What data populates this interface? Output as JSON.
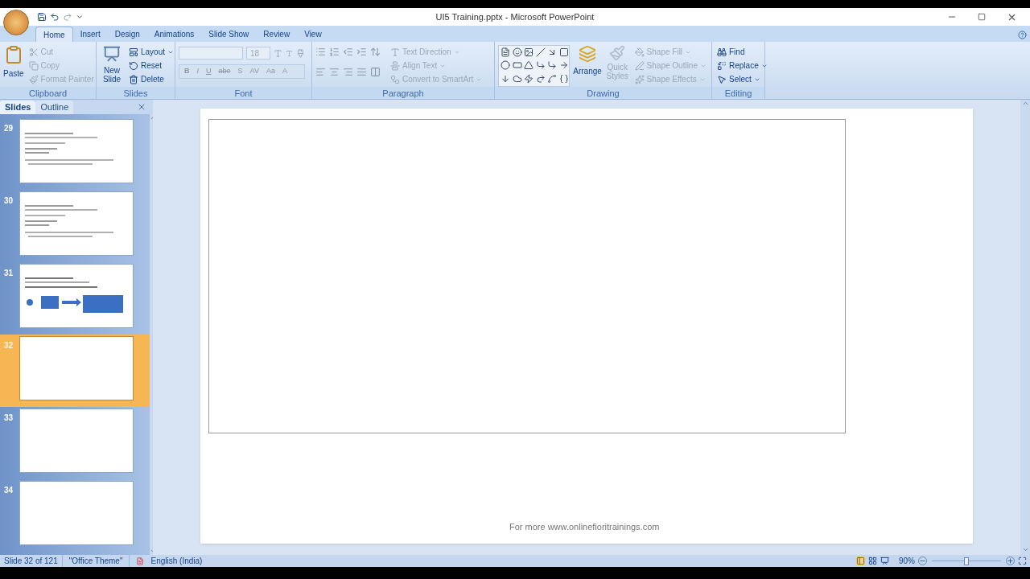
{
  "window": {
    "title": "UI5 Training.pptx - Microsoft PowerPoint"
  },
  "ribbon_tabs": [
    {
      "label": "Home",
      "selected": true
    },
    {
      "label": "Insert",
      "selected": false
    },
    {
      "label": "Design",
      "selected": false
    },
    {
      "label": "Animations",
      "selected": false
    },
    {
      "label": "Slide Show",
      "selected": false
    },
    {
      "label": "Review",
      "selected": false
    },
    {
      "label": "View",
      "selected": false
    }
  ],
  "ribbon": {
    "clipboard": {
      "title": "Clipboard",
      "paste": {
        "label": "Paste",
        "disabled": false
      },
      "small": [
        {
          "label": "Cut",
          "disabled": true,
          "menu": false
        },
        {
          "label": "Copy",
          "disabled": true,
          "menu": false
        },
        {
          "label": "Format Painter",
          "disabled": true,
          "menu": false
        }
      ]
    },
    "slides": {
      "title": "Slides",
      "new_slide": {
        "label": "New Slide",
        "disabled": false
      },
      "small": [
        {
          "label": "Layout",
          "disabled": false,
          "menu": true
        },
        {
          "label": "Reset",
          "disabled": false,
          "menu": false
        },
        {
          "label": "Delete",
          "disabled": false,
          "menu": false
        }
      ]
    },
    "font": {
      "title": "Font",
      "size": "18",
      "format_buttons": [
        "B",
        "I",
        "U",
        "abe",
        "S",
        "AV",
        "Aa",
        "A"
      ]
    },
    "paragraph": {
      "title": "Paragraph",
      "small": [
        {
          "label": "Text Direction",
          "disabled": true,
          "menu": true
        },
        {
          "label": "Align Text",
          "disabled": true,
          "menu": true
        },
        {
          "label": "Convert to SmartArt",
          "disabled": true,
          "menu": true
        }
      ]
    },
    "drawing": {
      "title": "Drawing",
      "arrange": {
        "label": "Arrange",
        "disabled": false
      },
      "quick_styles": {
        "label": "Quick Styles",
        "disabled": true
      },
      "small": [
        {
          "label": "Shape Fill",
          "disabled": true,
          "menu": true
        },
        {
          "label": "Shape Outline",
          "disabled": true,
          "menu": true
        },
        {
          "label": "Shape Effects",
          "disabled": true,
          "menu": true
        }
      ]
    },
    "editing": {
      "title": "Editing",
      "small": [
        {
          "label": "Find",
          "disabled": false,
          "menu": false
        },
        {
          "label": "Replace",
          "disabled": false,
          "menu": true
        },
        {
          "label": "Select",
          "disabled": false,
          "menu": true
        }
      ]
    }
  },
  "panel_tabs": [
    {
      "label": "Slides",
      "selected": true
    },
    {
      "label": "Outline",
      "selected": false
    }
  ],
  "slides": [
    {
      "number": "29",
      "kind": "text",
      "selected": false
    },
    {
      "number": "30",
      "kind": "text",
      "selected": false
    },
    {
      "number": "31",
      "kind": "diagram",
      "selected": false
    },
    {
      "number": "32",
      "kind": "blank",
      "selected": true
    },
    {
      "number": "33",
      "kind": "blank",
      "selected": false
    },
    {
      "number": "34",
      "kind": "blank",
      "selected": false
    }
  ],
  "slide": {
    "footer": "For more www.onlinefioritrainings.com"
  },
  "status_bar": {
    "slide": "Slide 32 of 121",
    "theme": "\"Office Theme\"",
    "language": "English (India)",
    "zoom": "90%",
    "zoom_level": {
      "level": 0.5
    }
  }
}
